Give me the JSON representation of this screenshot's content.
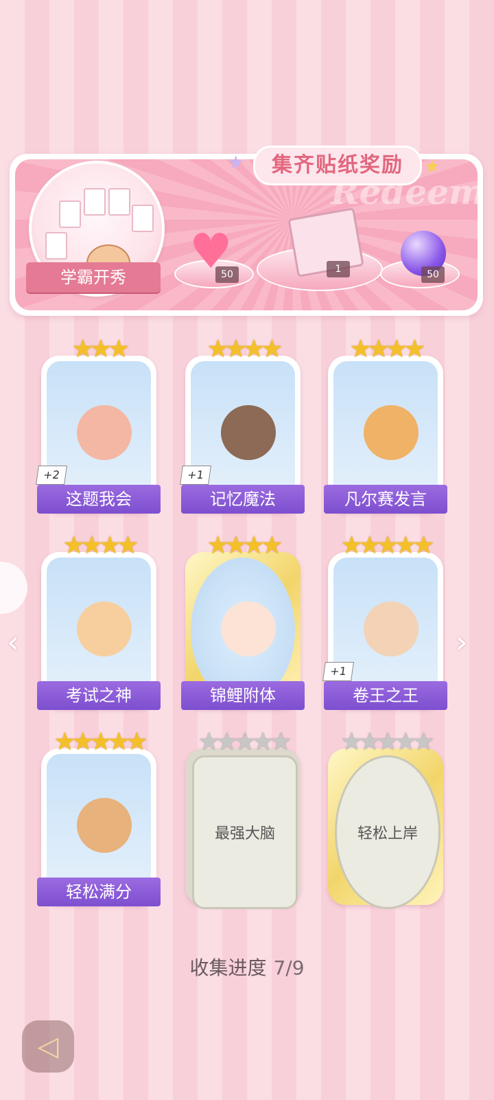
{
  "banner": {
    "title": "集齐贴纸奖励",
    "watermark": "Redeem",
    "badge_label": "学霸开秀",
    "rewards": [
      {
        "icon": "pink-heart-gem-icon",
        "count": "50"
      },
      {
        "icon": "gift-box-icon",
        "count": "1"
      },
      {
        "icon": "purple-lightning-orb-icon",
        "count": "50"
      }
    ]
  },
  "stickers": [
    {
      "label": "这题我会",
      "stars": 3,
      "bonus": "+2",
      "collected": true,
      "frame": "blue"
    },
    {
      "label": "记忆魔法",
      "stars": 4,
      "bonus": "+1",
      "collected": true,
      "frame": "blue"
    },
    {
      "label": "凡尔赛发言",
      "stars": 4,
      "bonus": "",
      "collected": true,
      "frame": "blue"
    },
    {
      "label": "考试之神",
      "stars": 4,
      "bonus": "",
      "collected": true,
      "frame": "blue"
    },
    {
      "label": "锦鲤附体",
      "stars": 4,
      "bonus": "",
      "collected": true,
      "frame": "gold"
    },
    {
      "label": "卷王之王",
      "stars": 5,
      "bonus": "+1",
      "collected": true,
      "frame": "blue"
    },
    {
      "label": "轻松满分",
      "stars": 5,
      "bonus": "",
      "collected": true,
      "frame": "blue"
    },
    {
      "label": "最强大脑",
      "stars": 5,
      "bonus": "",
      "collected": false,
      "frame": "silver"
    },
    {
      "label": "轻松上岸",
      "stars": 5,
      "bonus": "",
      "collected": false,
      "frame": "gold"
    }
  ],
  "progress": {
    "label": "收集进度",
    "value": "7/9"
  },
  "colors": {
    "accent_purple": "#8a5bd8",
    "banner_pink": "#f7a9bd",
    "star_gold": "#f4c02a"
  }
}
